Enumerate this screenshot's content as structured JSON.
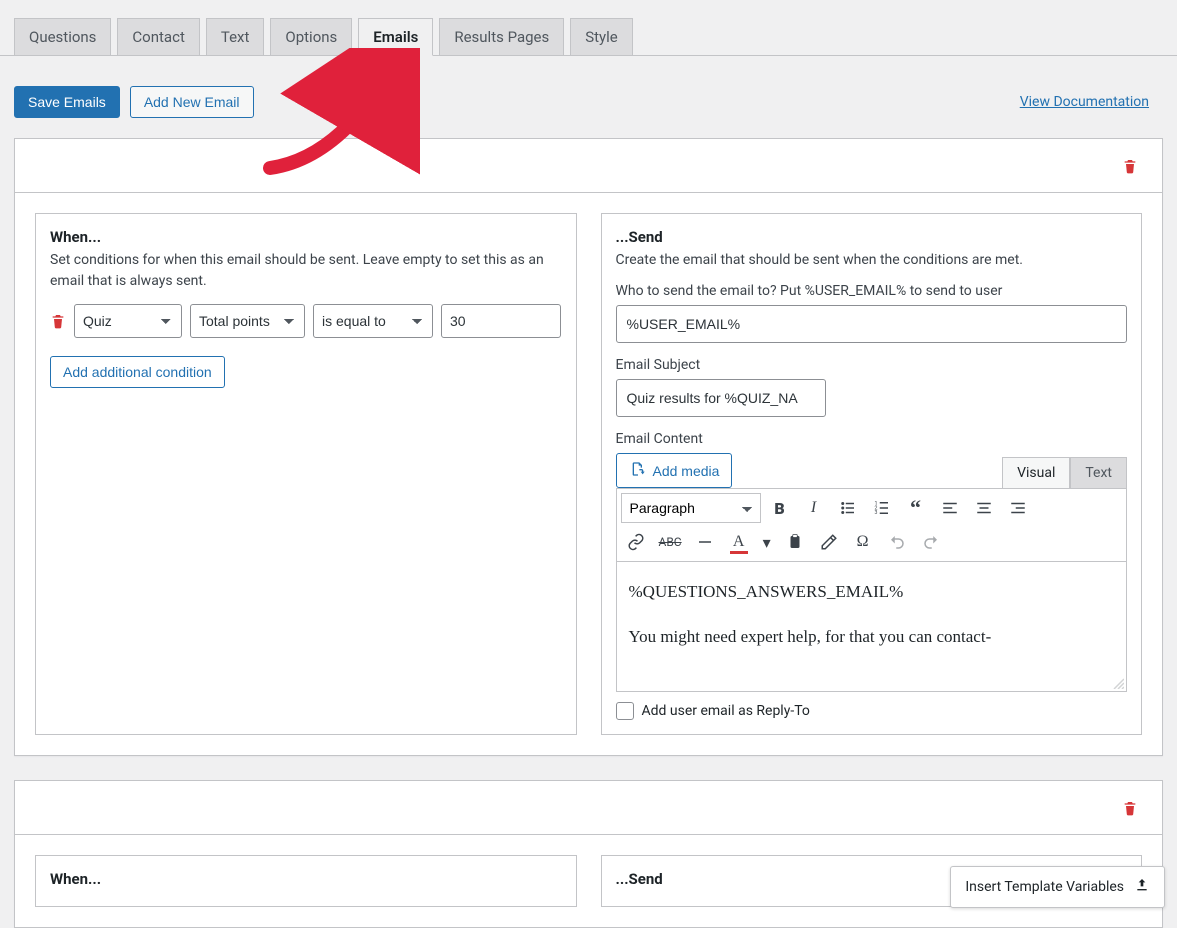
{
  "tabs": {
    "questions": "Questions",
    "contact": "Contact",
    "text": "Text",
    "options": "Options",
    "emails": "Emails",
    "results_pages": "Results Pages",
    "style": "Style"
  },
  "actions": {
    "save_emails": "Save Emails",
    "add_new_email": "Add New Email",
    "view_doc": "View Documentation"
  },
  "when_panel": {
    "heading": "When...",
    "help": "Set conditions for when this email should be sent. Leave empty to set this as an email that is always sent.",
    "criteria_value": "Quiz",
    "metric_value": "Total points",
    "operator_value": "is equal to",
    "cond_value": "30",
    "add_condition": "Add additional condition"
  },
  "send_panel": {
    "heading": "...Send",
    "help": "Create the email that should be sent when the conditions are met.",
    "who_label": "Who to send the email to? Put %USER_EMAIL% to send to user",
    "who_value": "%USER_EMAIL%",
    "subject_label": "Email Subject",
    "subject_value": "Quiz results for %QUIZ_NA",
    "content_label": "Email Content",
    "add_media": "Add media",
    "editor_tabs": {
      "visual": "Visual",
      "text": "Text"
    },
    "format_select": "Paragraph",
    "editor_line1": "%QUESTIONS_ANSWERS_EMAIL%",
    "editor_line2": "You might need expert help, for that you can contact-",
    "reply_to_label": "Add user email as Reply-To"
  },
  "second_card": {
    "when_heading": "When...",
    "send_heading": "...Send"
  },
  "float_button": "Insert Template Variables"
}
